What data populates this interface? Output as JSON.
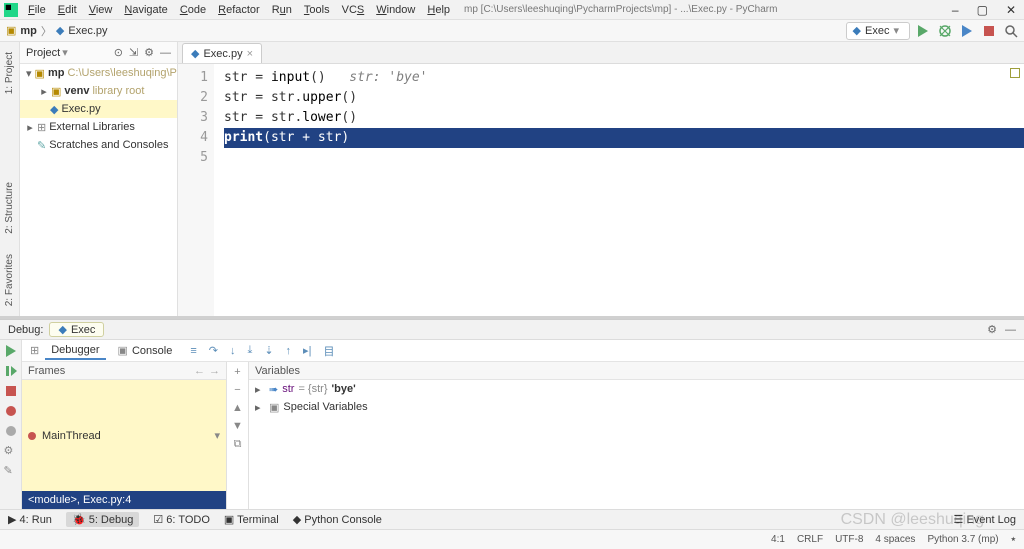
{
  "menubar": {
    "items": [
      "File",
      "Edit",
      "View",
      "Navigate",
      "Code",
      "Refactor",
      "Run",
      "Tools",
      "VCS",
      "Window",
      "Help"
    ],
    "title": "mp [C:\\Users\\leeshuqing\\PycharmProjects\\mp] - ...\\Exec.py - PyCharm"
  },
  "window_buttons": {
    "min": "–",
    "max": "▢",
    "close": "✕"
  },
  "breadcrumb": {
    "root": "mp",
    "file": "Exec.py"
  },
  "run_config": {
    "name": "Exec"
  },
  "project": {
    "header": "Project",
    "root": "mp",
    "root_hint": "C:\\Users\\leeshuqing\\Py",
    "venv": "venv",
    "venv_hint": "library root",
    "file": "Exec.py",
    "external": "External Libraries",
    "scratches": "Scratches and Consoles"
  },
  "side_tabs": {
    "project": "1: Project",
    "structure": "2: Structure",
    "favorites": "2: Favorites"
  },
  "tab": {
    "name": "Exec.py"
  },
  "code": {
    "lines": [
      {
        "n": "1",
        "pre": "str = ",
        "kw": "input",
        "post": "()",
        "cm": "   str: 'bye'"
      },
      {
        "n": "2",
        "pre": "str = str.",
        "kw": "upper",
        "post": "()",
        "cm": ""
      },
      {
        "n": "3",
        "pre": "str = str.",
        "kw": "lower",
        "post": "()",
        "cm": ""
      },
      {
        "n": "4",
        "pre": "",
        "kw": "print",
        "post": "(str + str)",
        "cm": "",
        "hl": true,
        "bp": true
      },
      {
        "n": "5",
        "pre": "",
        "kw": "",
        "post": "",
        "cm": ""
      }
    ]
  },
  "debug": {
    "title": "Debug:",
    "config": "Exec",
    "tabs": {
      "debugger": "Debugger",
      "console": "Console"
    },
    "frames_header": "Frames",
    "variables_header": "Variables",
    "frame_main": "MainThread",
    "frame_module": "<module>, Exec.py:4",
    "var_str_name": "str",
    "var_str_eq": "= {str}",
    "var_str_val": "'bye'",
    "var_special": "Special Variables"
  },
  "bottom_tabs": {
    "run": "4: Run",
    "debug": "5: Debug",
    "todo": "6: TODO",
    "terminal": "Terminal",
    "python": "Python Console",
    "eventlog": "Event Log"
  },
  "status": {
    "pos": "4:1",
    "eol": "CRLF",
    "enc": "UTF-8",
    "indent": "4 spaces",
    "interp": "Python 3.7 (mp)",
    "lock": "⭑"
  },
  "watermark": "CSDN @leeshuqing"
}
